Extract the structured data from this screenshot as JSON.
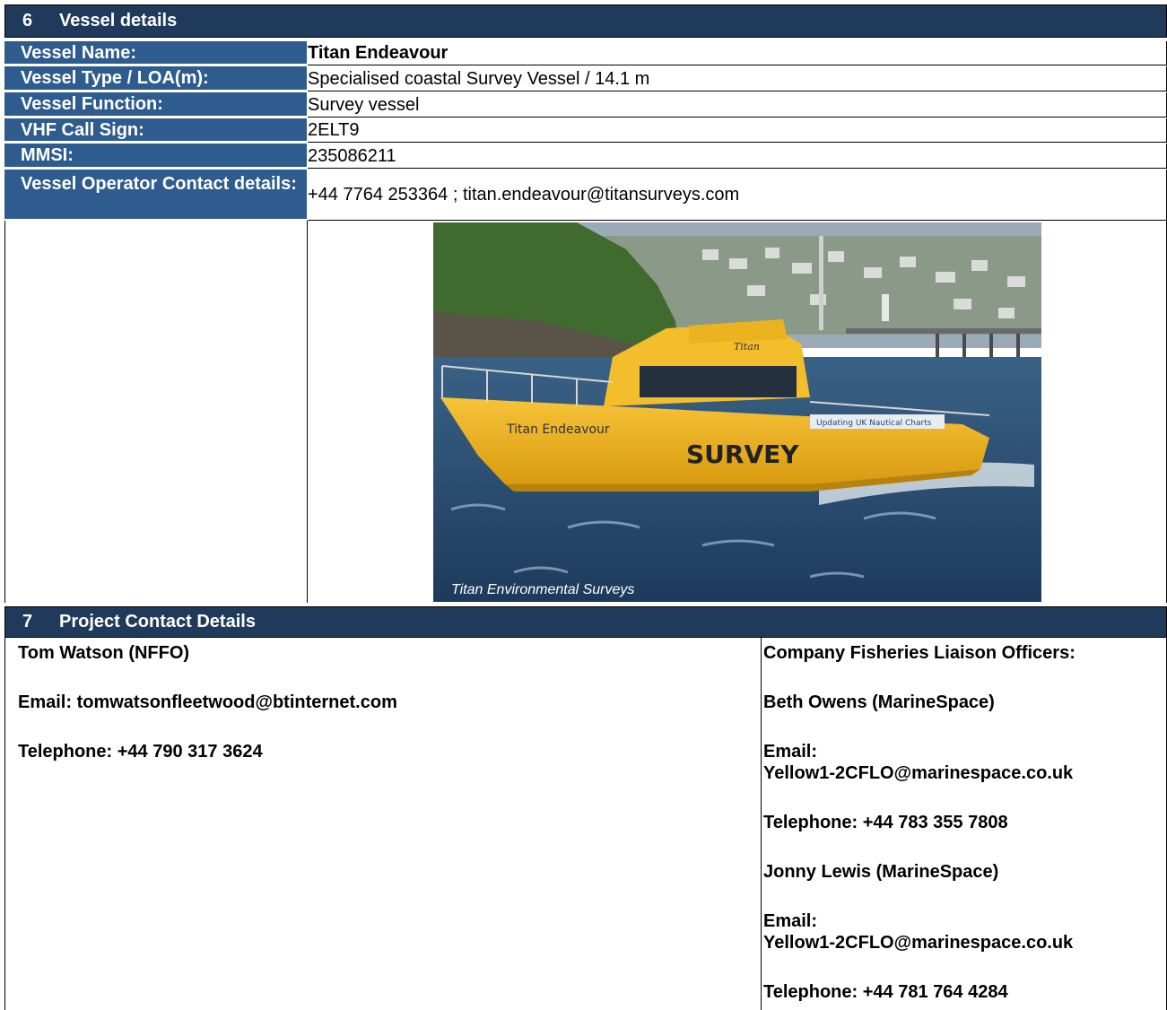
{
  "section6": {
    "number": "6",
    "title": "Vessel details",
    "rows": [
      {
        "label": "Vessel Name:",
        "value": "Titan Endeavour",
        "bold": true
      },
      {
        "label": "Vessel Type / LOA(m):",
        "value": "Specialised coastal Survey Vessel / 14.1 m"
      },
      {
        "label": "Vessel Function:",
        "value": "Survey vessel"
      },
      {
        "label": "VHF Call Sign:",
        "value": "2ELT9"
      },
      {
        "label": "MMSI:",
        "value": "235086211"
      },
      {
        "label": "Vessel Operator Contact details:",
        "value": "+44 7764 253364 ; titan.endeavour@titansurveys.com"
      }
    ],
    "photo": {
      "caption": "Titan Environmental Surveys",
      "hull_name": "Titan Endeavour",
      "hull_text": "SURVEY",
      "banner": "Updating UK Nautical Charts",
      "cabin_logo": "Titan",
      "colors": {
        "hull": "#f2b51c",
        "sea": "#2a4d74",
        "hill": "#3f6b2e",
        "sky": "#8fa3b3"
      }
    }
  },
  "section7": {
    "number": "7",
    "title": "Project Contact Details",
    "left": {
      "name": "Tom Watson (NFFO)",
      "email": "Email: tomwatsonfleetwood@btinternet.com",
      "phone": "Telephone: +44 790 317 3624"
    },
    "right": {
      "heading": "Company Fisheries Liaison Officers:",
      "contacts": [
        {
          "name": "Beth Owens (MarineSpace)",
          "email_label": "Email:",
          "email": "Yellow1-2CFLO@marinespace.co.uk",
          "phone": "Telephone: +44 783 355 7808"
        },
        {
          "name": "Jonny Lewis (MarineSpace)",
          "email_label": "Email:",
          "email": "Yellow1-2CFLO@marinespace.co.uk",
          "phone": "Telephone: +44 781 764 4284"
        }
      ]
    }
  },
  "colors": {
    "header_bg": "#203a5c",
    "label_bg": "#2e5c8e"
  }
}
